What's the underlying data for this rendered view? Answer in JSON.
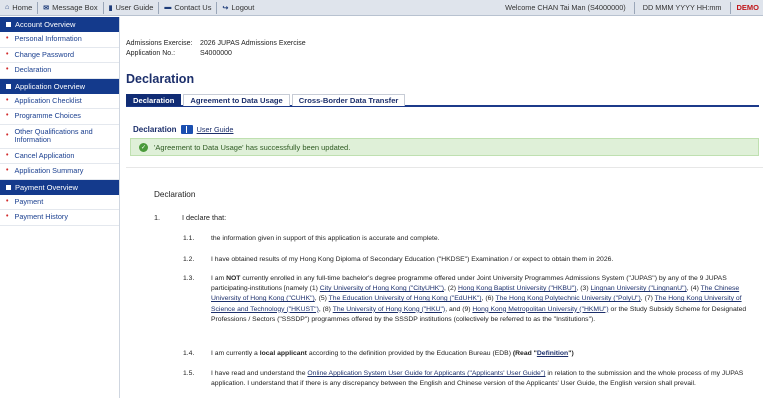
{
  "topbar": {
    "home": "Home",
    "message_box": "Message Box",
    "user_guide": "User Guide",
    "contact_us": "Contact Us",
    "logout": "Logout",
    "welcome": "Welcome CHAN Tai Man (S4000000)",
    "date": "DD MMM YYYY HH:mm",
    "demo": "DEMO"
  },
  "sidebar": {
    "sec1": "Account Overview",
    "sec1_items": [
      "Personal Information",
      "Change Password",
      "Declaration"
    ],
    "sec2": "Application Overview",
    "sec2_items": [
      "Application Checklist",
      "Programme Choices",
      "Other Qualifications and Information",
      "Cancel Application",
      "Application Summary"
    ],
    "sec3": "Payment Overview",
    "sec3_items": [
      "Payment",
      "Payment History"
    ]
  },
  "meta": {
    "exercise_label": "Admissions Exercise:",
    "exercise_value": "2026 JUPAS Admissions Exercise",
    "appno_label": "Application No.:",
    "appno_value": "S4000000"
  },
  "page_title": "Declaration",
  "tabs": [
    "Declaration",
    "Agreement to Data Usage",
    "Cross-Border Data Transfer"
  ],
  "sub_head": {
    "title": "Declaration",
    "link": "User Guide"
  },
  "alert": "'Agreement to Data Usage' has successfully been updated.",
  "doc": {
    "title": "Declaration",
    "item1_no": "1.",
    "item1_text": "I declare that:",
    "c11_no": "1.1.",
    "c11": "the information given in support of this application is accurate and complete.",
    "c12_no": "1.2.",
    "c12": "I have obtained results of my Hong Kong Diploma of Secondary Education (\"HKDSE\") Examination / or expect to obtain them in 2026.",
    "c13_no": "1.3.",
    "c13_a": "I am ",
    "c13_not": "NOT",
    "c13_b": " currently enrolled in any full-time bachelor's degree programme offered under Joint University Programmes Admissions System (\"JUPAS\") by any of the 9 JUPAS participating-institutions [namely (1) ",
    "c13_u1": "City University of Hong Kong (\"CityUHK\")",
    "c13_c": ", (2) ",
    "c13_u2": "Hong Kong Baptist University (\"HKBU\")",
    "c13_d": ", (3) ",
    "c13_u3": "Lingnan University (\"LingnanU\")",
    "c13_e": ", (4) ",
    "c13_u4": "The Chinese University of Hong Kong (\"CUHK\")",
    "c13_f": ", (5) ",
    "c13_u5": "The Education University of Hong Kong (\"EdUHK\")",
    "c13_g": ", (6) ",
    "c13_u6": "The Hong Kong Polytechnic University (\"PolyU\")",
    "c13_h": ", (7) ",
    "c13_u7": "The Hong Kong University of Science and Technology (\"HKUST\")",
    "c13_i": ", (8) ",
    "c13_u8": "The University of Hong Kong (\"HKU\")",
    "c13_j": ", and (9) ",
    "c13_u9": "Hong Kong Metropolitan University (\"HKMU\")",
    "c13_k": " or the Study Subsidy Scheme for Designated Professions / Sectors (\"SSSDP\") programmes offered by the SSSDP institutions (collectively be referred to as the \"Institutions\").",
    "c14_no": "1.4.",
    "c14_a": "I am currently a ",
    "c14_b": "local applicant",
    "c14_c": " according to the definition provided by the Education Bureau (EDB) ",
    "c14_d": "(Read \"",
    "c14_link": "Definition",
    "c14_e": "\")",
    "c15_no": "1.5.",
    "c15_a": "I have read and understand the ",
    "c15_link": "Online Application System User Guide for Applicants (\"Applicants' User Guide\")",
    "c15_b": " in relation to the submission and the whole process of my JUPAS application. I understand that if there is any discrepancy between the English and Chinese version of the Applicants' User Guide, the English version shall prevail."
  },
  "colors": {
    "nav_blue": "#143a8c",
    "bullet_red": "#d12a2a",
    "success_bg": "#dff0d8",
    "demo_red": "#c0161a"
  }
}
